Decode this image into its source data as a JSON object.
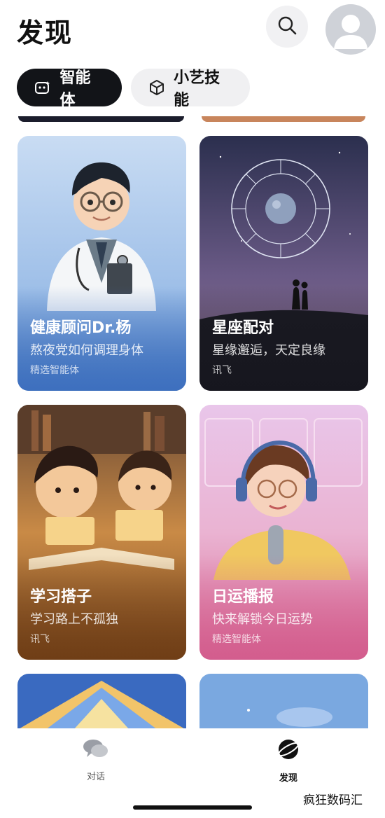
{
  "header": {
    "title": "发现"
  },
  "tabs": [
    {
      "label": "智能体",
      "active": true
    },
    {
      "label": "小艺技能",
      "active": false
    }
  ],
  "cards": [
    {
      "title": "健康顾问Dr.杨",
      "subtitle": "熬夜党如何调理身体",
      "source": "精选智能体"
    },
    {
      "title": "星座配对",
      "subtitle": "星缘邂逅，天定良缘",
      "source": "讯飞"
    },
    {
      "title": "学习搭子",
      "subtitle": "学习路上不孤独",
      "source": "讯飞"
    },
    {
      "title": "日运播报",
      "subtitle": "快来解锁今日运势",
      "source": "精选智能体"
    }
  ],
  "nav": [
    {
      "label": "对话"
    },
    {
      "label": "发现"
    }
  ],
  "watermark": "疯狂数码汇",
  "colors": {
    "accent": "#121418",
    "tab_inactive": "#f0f0f2"
  }
}
